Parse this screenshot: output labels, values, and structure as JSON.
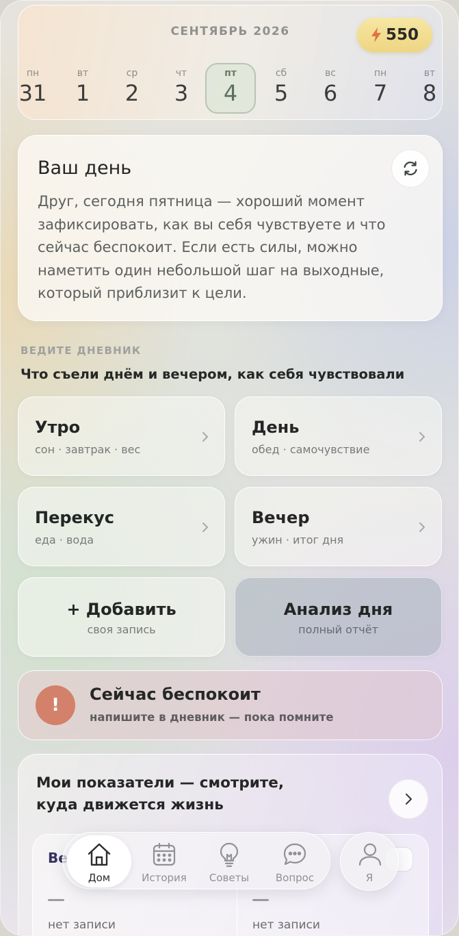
{
  "header": {
    "month": "СЕНТЯБРЬ 2026",
    "points": "550",
    "days": [
      {
        "weekday": "пн",
        "num": "31"
      },
      {
        "weekday": "вт",
        "num": "1"
      },
      {
        "weekday": "ср",
        "num": "2"
      },
      {
        "weekday": "чт",
        "num": "3"
      },
      {
        "weekday": "пт",
        "num": "4"
      },
      {
        "weekday": "сб",
        "num": "5"
      },
      {
        "weekday": "вс",
        "num": "6"
      },
      {
        "weekday": "пн",
        "num": "7"
      },
      {
        "weekday": "вт",
        "num": "8"
      }
    ],
    "selected_day": "4"
  },
  "your_day": {
    "title": "Ваш день",
    "text": "Друг, сегодня пятница — хороший момент зафиксировать, как вы себя чувствуете и что сейчас беспокоит. Если есть силы, можно наметить один небольшой шаг на выходные, который приблизит к цели."
  },
  "diary": {
    "caption": "ВЕДИТЕ ДНЕВНИК",
    "subtitle": "Что съели днём и вечером, как себя чувствовали",
    "tiles": [
      {
        "title": "Утро",
        "sub": "сон · завтрак · вес"
      },
      {
        "title": "День",
        "sub": "обед · самочувствие"
      },
      {
        "title": "Перекус",
        "sub": "еда · вода"
      },
      {
        "title": "Вечер",
        "sub": "ужин · итог дня"
      }
    ],
    "add": {
      "title": "+ Добавить",
      "sub": "своя запись"
    },
    "analysis": {
      "title": "Анализ дня",
      "sub": "полный отчёт"
    }
  },
  "worry": {
    "icon": "!",
    "title": "Сейчас беспокоит",
    "sub": "напишите в дневник — пока помните"
  },
  "metrics": {
    "title": "Мои показатели — смотрите, куда движется жизнь",
    "left_heading": "Ве",
    "left_value": "нет записи",
    "right_value": "нет записи"
  },
  "nav": {
    "items": [
      {
        "label": "Дом",
        "icon": "home-icon"
      },
      {
        "label": "История",
        "icon": "calendar-icon"
      },
      {
        "label": "Советы",
        "icon": "lightbulb-icon"
      },
      {
        "label": "Вопрос",
        "icon": "chat-icon"
      }
    ],
    "profile_label": "Я"
  },
  "colors": {
    "accent_points": "#eed582",
    "alert": "#d3816a",
    "selected_day": "#5c6f5c"
  }
}
